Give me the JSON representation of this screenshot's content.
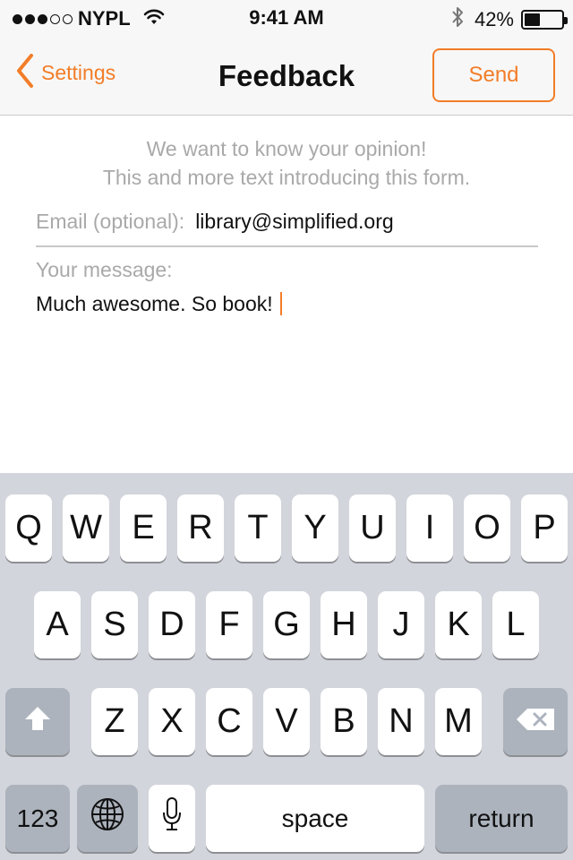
{
  "status_bar": {
    "carrier": "NYPL",
    "signal_bars": 3,
    "signal_total": 5,
    "time": "9:41 AM",
    "battery_percent": "42%",
    "battery_level": 0.42
  },
  "nav": {
    "back_label": "Settings",
    "title": "Feedback",
    "send_label": "Send"
  },
  "form": {
    "intro_line1": "We want to know your opinion!",
    "intro_line2": "This and more text introducing this form.",
    "email_label": "Email (optional):",
    "email_value": "library@simplified.org",
    "message_label": "Your message:",
    "message_value": "Much awesome. So book!"
  },
  "keyboard": {
    "row1": [
      "Q",
      "W",
      "E",
      "R",
      "T",
      "Y",
      "U",
      "I",
      "O",
      "P"
    ],
    "row2": [
      "A",
      "S",
      "D",
      "F",
      "G",
      "H",
      "J",
      "K",
      "L"
    ],
    "row3": [
      "Z",
      "X",
      "C",
      "V",
      "B",
      "N",
      "M"
    ],
    "numbers_label": "123",
    "space_label": "space",
    "return_label": "return"
  },
  "colors": {
    "accent": "#f27d28",
    "keyboard_bg": "#d2d5db",
    "special_key": "#acb3bd",
    "placeholder_gray": "#a9a9a9"
  }
}
